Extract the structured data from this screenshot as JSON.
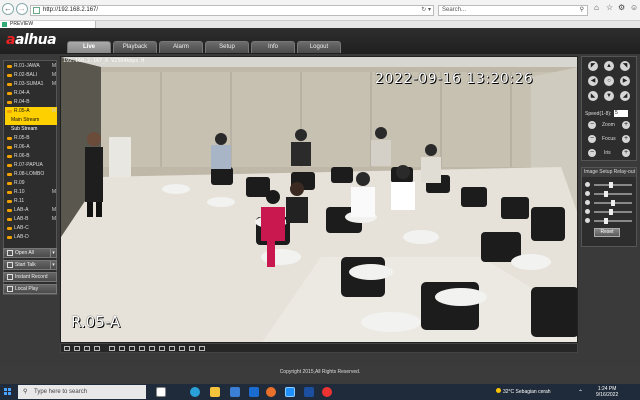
{
  "browser": {
    "url": "http://192.168.2.167/",
    "search_placeholder": "Search...",
    "tab_title": "PREVIEW"
  },
  "app": {
    "logo_main": "alhua",
    "nav": [
      "Live",
      "Playback",
      "Alarm",
      "Setup",
      "Info",
      "Logout"
    ],
    "active_nav": "Live"
  },
  "cameras": [
    {
      "label": "R.01-JAWA",
      "m": "M"
    },
    {
      "label": "R.02-BALI",
      "m": "M"
    },
    {
      "label": "R.03-SUMA1",
      "m": "M"
    },
    {
      "label": "R.04-A",
      "m": ""
    },
    {
      "label": "R.04-B",
      "m": ""
    },
    {
      "label": "R.05-A",
      "m": "M"
    },
    {
      "label": "R.05-B",
      "m": ""
    },
    {
      "label": "R.06-A",
      "m": ""
    },
    {
      "label": "R.06-B",
      "m": ""
    },
    {
      "label": "R.07-PAPUA",
      "m": ""
    },
    {
      "label": "R.08-LOMBO",
      "m": ""
    },
    {
      "label": "R.09",
      "m": ""
    },
    {
      "label": "R.10",
      "m": "M"
    },
    {
      "label": "R.11",
      "m": ""
    },
    {
      "label": "LAB-A",
      "m": "M"
    },
    {
      "label": "LAB-B",
      "m": "M"
    },
    {
      "label": "LAB-C",
      "m": ""
    },
    {
      "label": "LAB-D",
      "m": ""
    }
  ],
  "streams": {
    "main": "Main Stream",
    "sub": "Sub Stream"
  },
  "left_buttons": [
    "Open All",
    "Start Talk",
    "Instant Record",
    "Local Play"
  ],
  "video": {
    "osd_info": "192.168.2.167_6  V2304kbps H",
    "timestamp": "2022-09-16 13:20:26",
    "channel_name": "R.05-A"
  },
  "ptz": {
    "speed_label": "Speed(1-8):",
    "speed_value": "5",
    "zoom": "Zoom",
    "focus": "Focus",
    "iris": "Iris"
  },
  "image_setup": {
    "title": "Image Setup",
    "relay": "Relay-out",
    "reset": "Reset",
    "levels": [
      0.45,
      0.3,
      0.5,
      0.45,
      0.3
    ]
  },
  "footer": "Copyright 2015,All Rights Reserved.",
  "taskbar": {
    "search": "Type here to search",
    "weather": "32°C  Sebagian cerah",
    "time": "1:24 PM",
    "date": "9/16/2022"
  },
  "colors": {
    "accent": "#ffd000",
    "logo_red": "#e22222"
  }
}
